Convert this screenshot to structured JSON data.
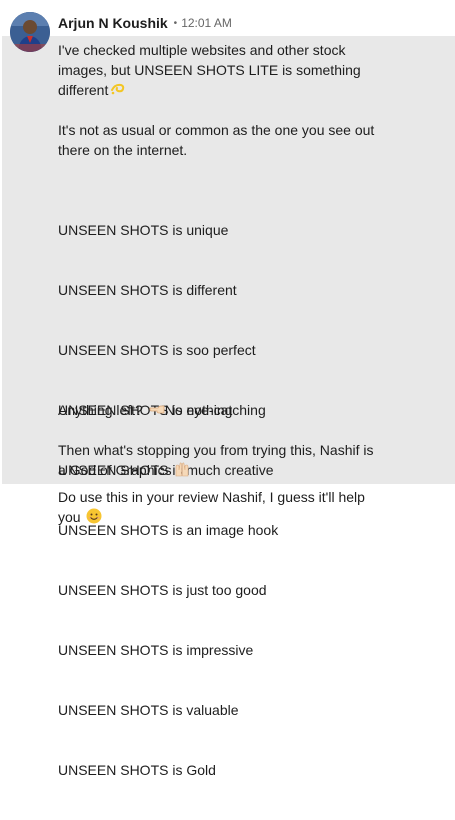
{
  "message": {
    "sender": {
      "name": "Arjun N Koushik",
      "separator": "•",
      "time": "12:01 AM",
      "avatar_icon": "profile-photo"
    },
    "highlighted_paragraphs": {
      "p1_line1": "I've checked multiple websites and other stock",
      "p1_line2": "images, but UNSEEN SHOTS LITE is something",
      "p1_line3": "different",
      "p1_emoji": "dizzy-emoji",
      "p2_line1": "It's not as usual or common as the one you see out",
      "p2_line2": "there on the internet.",
      "list": [
        "UNSEEN SHOTS is unique",
        "UNSEEN SHOTS is different",
        "UNSEEN SHOTS is soo perfect",
        "UNSEEN SHOTS is eye-catching",
        "UNSEEN SHOTS is much creative",
        "UNSEEN SHOTS is an image hook",
        "UNSEEN SHOTS is just too good",
        "UNSEEN SHOTS is impressive",
        "UNSEEN SHOTS is valuable",
        "UNSEEN SHOTS is Gold"
      ],
      "p4_before": "Anything left?",
      "p4_emoji": "pointing-left-emoji",
      "p4_after": "No nothing",
      "p5_line1": "Then what's stopping you from trying this, Nashif is",
      "p5_line2": "a God of Graphics",
      "p5_emoji": "raised-hands-emoji"
    },
    "plain_paragraph": {
      "line1": "Do use this in your review Nashif, I guess it'll help",
      "line2": "you",
      "emoji": "smiling-face-emoji"
    }
  },
  "colors": {
    "highlight_bg": "#e8e8e8",
    "text": "#1d1d1d",
    "muted": "#666666"
  }
}
